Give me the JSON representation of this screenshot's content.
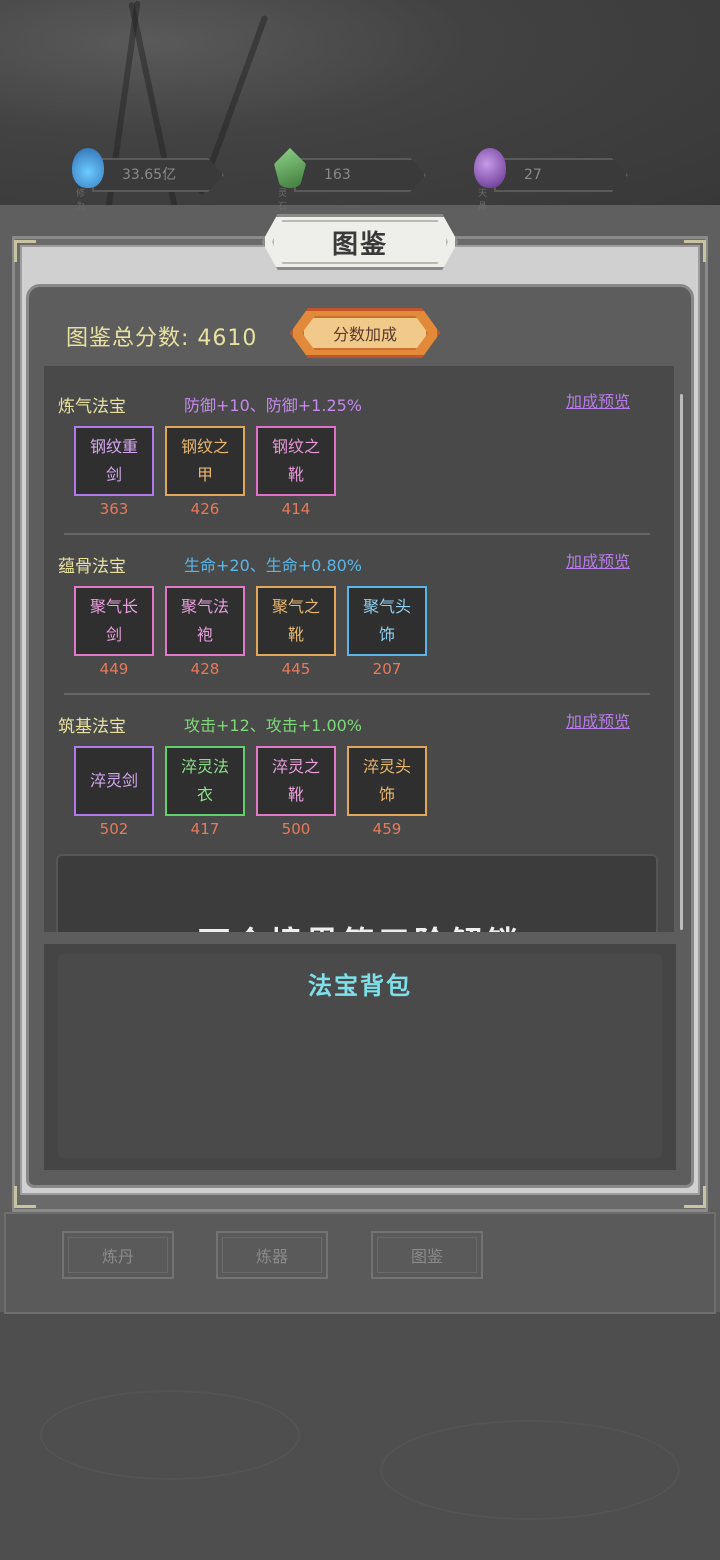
{
  "resources": [
    {
      "value": "33.65亿",
      "label": "修为",
      "icon": "blue-flame-icon",
      "color": "#4aa8e8"
    },
    {
      "value": "163",
      "label": "灵石",
      "icon": "green-crystal-icon",
      "color": "#5fae5a"
    },
    {
      "value": "27",
      "label": "天晶",
      "icon": "purple-gem-icon",
      "color": "#9a62c8"
    }
  ],
  "title": "图鉴",
  "score": {
    "label": "图鉴总分数:",
    "value": "4610",
    "button_label": "分数加成"
  },
  "sections": [
    {
      "name": "炼气法宝",
      "bonus": "防御+10、防御+1.25%",
      "bonus_color": "#c48aea",
      "preview_label": "加成预览",
      "items": [
        {
          "name": "钢纹重剑",
          "score": "363",
          "border": "#b07ae8",
          "color": "#d4a8f0"
        },
        {
          "name": "钢纹之甲",
          "score": "426",
          "border": "#e0a85a",
          "color": "#e8b870"
        },
        {
          "name": "钢纹之靴",
          "score": "414",
          "border": "#e070c8",
          "color": "#e898d8"
        }
      ]
    },
    {
      "name": "蕴骨法宝",
      "bonus": "生命+20、生命+0.80%",
      "bonus_color": "#5ab6e8",
      "preview_label": "加成预览",
      "items": [
        {
          "name": "聚气长剑",
          "score": "449",
          "border": "#e07ac8",
          "color": "#eaa0dc"
        },
        {
          "name": "聚气法袍",
          "score": "428",
          "border": "#e07ac8",
          "color": "#eaa0dc"
        },
        {
          "name": "聚气之靴",
          "score": "445",
          "border": "#e0a85a",
          "color": "#e8b870"
        },
        {
          "name": "聚气头饰",
          "score": "207",
          "border": "#5ab6e8",
          "color": "#8fd0f0"
        }
      ]
    },
    {
      "name": "筑基法宝",
      "bonus": "攻击+12、攻击+1.00%",
      "bonus_color": "#7ed87a",
      "preview_label": "加成预览",
      "items": [
        {
          "name": "淬灵剑",
          "score": "502",
          "border": "#b07ae8",
          "color": "#d4a8f0"
        },
        {
          "name": "淬灵法衣",
          "score": "417",
          "border": "#5fd06a",
          "color": "#8ee28a"
        },
        {
          "name": "淬灵之靴",
          "score": "500",
          "border": "#e07ac8",
          "color": "#eaa0dc"
        },
        {
          "name": "淬灵头饰",
          "score": "459",
          "border": "#e0a85a",
          "color": "#e8b870"
        }
      ]
    }
  ],
  "locked_text": "下个境界第三阶解锁",
  "backpack_title": "法宝背包",
  "tabs": [
    {
      "label": "炼丹"
    },
    {
      "label": "炼器"
    },
    {
      "label": "图鉴"
    }
  ]
}
